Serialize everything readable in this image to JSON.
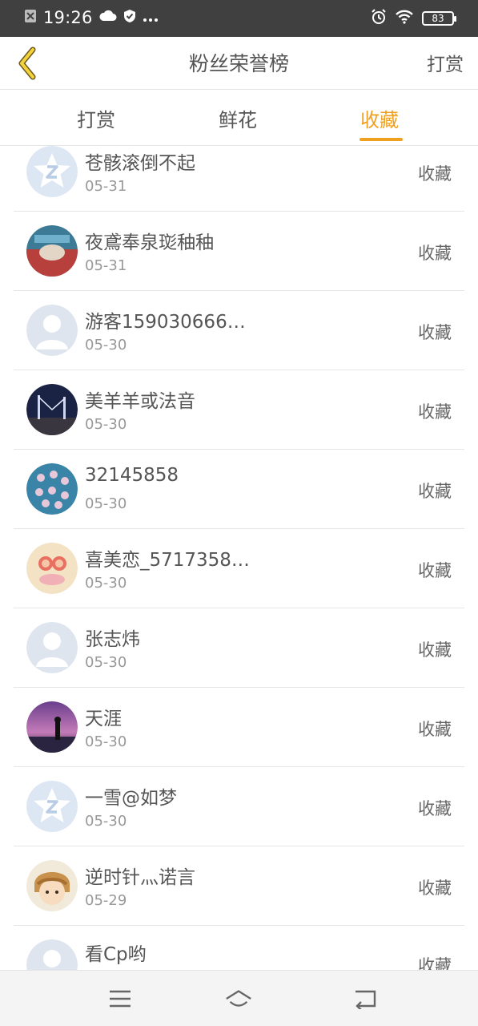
{
  "status_bar": {
    "time": "19:26",
    "battery": "83"
  },
  "header": {
    "title": "粉丝荣誉榜",
    "right_label": "打赏"
  },
  "tabs": [
    {
      "label": "打赏",
      "active": false
    },
    {
      "label": "鲜花",
      "active": false
    },
    {
      "label": "收藏",
      "active": true
    }
  ],
  "list": [
    {
      "name": "苍骸滚倒不起",
      "date": "05-31",
      "action": "收藏",
      "avatar": "qq-default-icon"
    },
    {
      "name": "夜鳶奉泉珳秞秞",
      "date": "05-31",
      "action": "收藏",
      "avatar": "photo"
    },
    {
      "name": "游客159030666…",
      "date": "05-30",
      "action": "收藏",
      "avatar": "person-placeholder-icon"
    },
    {
      "name": "美羊羊或法音",
      "date": "05-30",
      "action": "收藏",
      "avatar": "photo"
    },
    {
      "name": "32145858",
      "date": "05-30",
      "action": "收藏",
      "avatar": "photo"
    },
    {
      "name": "喜美恋_5717358…",
      "date": "05-30",
      "action": "收藏",
      "avatar": "photo"
    },
    {
      "name": "张志炜",
      "date": "05-30",
      "action": "收藏",
      "avatar": "person-placeholder-icon"
    },
    {
      "name": "天涯",
      "date": "05-30",
      "action": "收藏",
      "avatar": "photo"
    },
    {
      "name": "一雪@如梦",
      "date": "05-30",
      "action": "收藏",
      "avatar": "qq-default-icon"
    },
    {
      "name": "逆时针灬诺言",
      "date": "05-29",
      "action": "收藏",
      "avatar": "photo"
    },
    {
      "name": "看Cp哟",
      "date": "",
      "action": "收藏",
      "avatar": "person-placeholder-icon"
    }
  ],
  "colors": {
    "accent": "#f0a020",
    "status_bar": "#404040"
  }
}
